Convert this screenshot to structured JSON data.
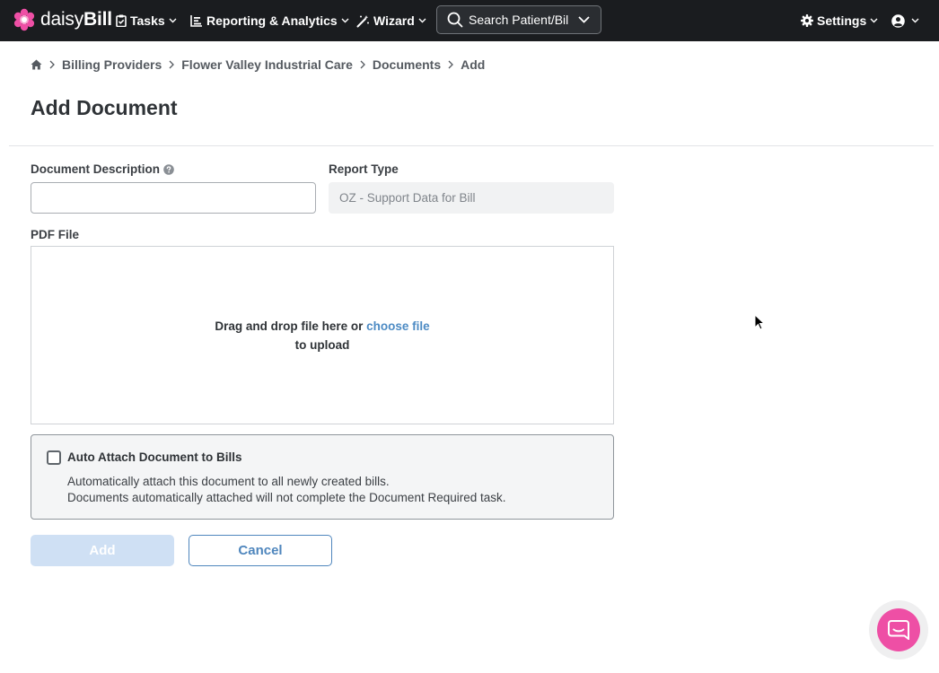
{
  "brand": {
    "name_light": "daisy",
    "name_bold": "Bill",
    "accent": "#ee4fa5"
  },
  "nav": {
    "tasks": "Tasks",
    "reporting": "Reporting & Analytics",
    "wizard": "Wizard",
    "search_placeholder": "Search Patient/Bill",
    "settings": "Settings",
    "icons": [
      "clipboard-icon",
      "chart-icon",
      "wand-icon",
      "search-icon",
      "gear-icon",
      "user-icon"
    ]
  },
  "breadcrumb": {
    "items": [
      "Billing Providers",
      "Flower Valley Industrial Care",
      "Documents",
      "Add"
    ]
  },
  "page": {
    "title": "Add Document"
  },
  "form": {
    "description_label": "Document Description",
    "description_value": "",
    "report_type_label": "Report Type",
    "report_type_value": "OZ - Support Data for Bill",
    "pdf_label": "PDF File",
    "drop_text": "Drag and drop file here or",
    "choose_file": "choose file",
    "drop_text_2": "to upload",
    "auto_attach": {
      "label": "Auto Attach Document to Bills",
      "checked": false,
      "desc_1": "Automatically attach this document to all newly created bills.",
      "desc_2": "Documents automatically attached will not complete the Document Required task."
    },
    "add_button": "Add",
    "cancel_button": "Cancel"
  },
  "colors": {
    "topbar": "#1a1c1f",
    "primary": "#4f86bd",
    "primary_disabled": "#cfe0f4"
  }
}
